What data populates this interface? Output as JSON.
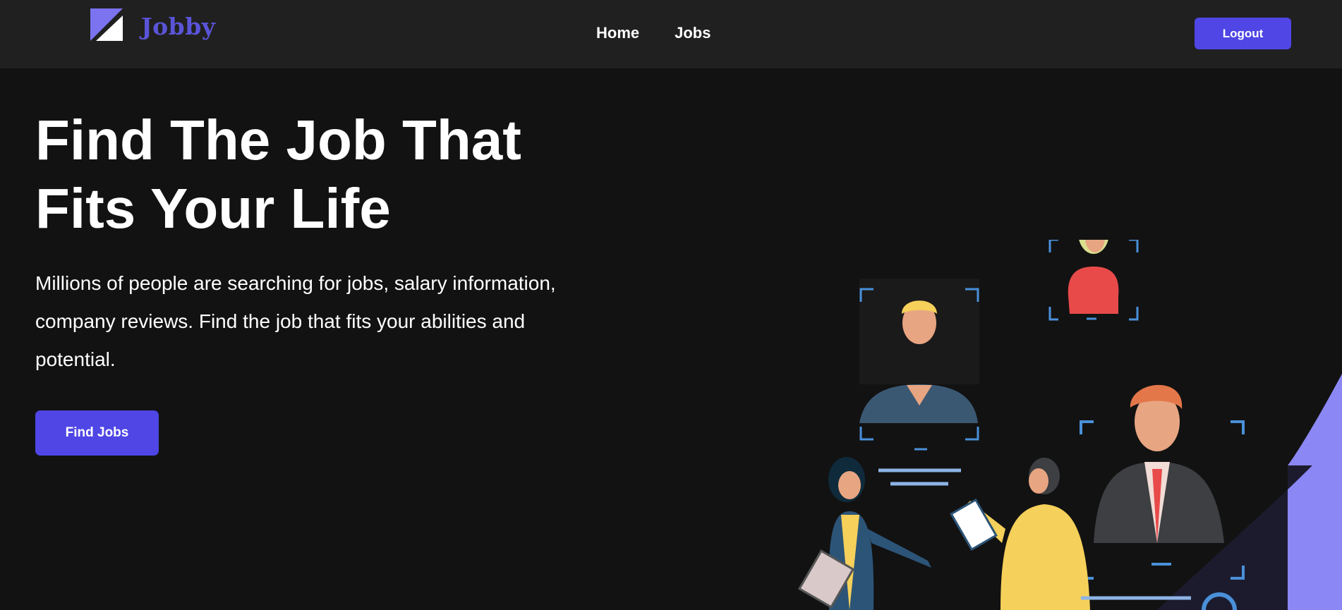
{
  "nav": {
    "brand": "Jobby",
    "logo_icon": "jobby-logo-icon",
    "links": [
      "Home",
      "Jobs"
    ],
    "logout_label": "Logout"
  },
  "hero": {
    "title_line1": "Find The Job That",
    "title_line2": "Fits Your Life",
    "description": "Millions of people are searching for jobs, salary information, company reviews. Find the job that fits your abilities and potential.",
    "cta_label": "Find Jobs",
    "illustration_icon": "people-recruitment-illustration"
  },
  "colors": {
    "background": "#121212",
    "navbar": "#202020",
    "accent": "#4f46e5",
    "brand_text": "#5a54d8",
    "illustration_blue": "#4a90d9",
    "accent_light": "#8b87f4"
  }
}
